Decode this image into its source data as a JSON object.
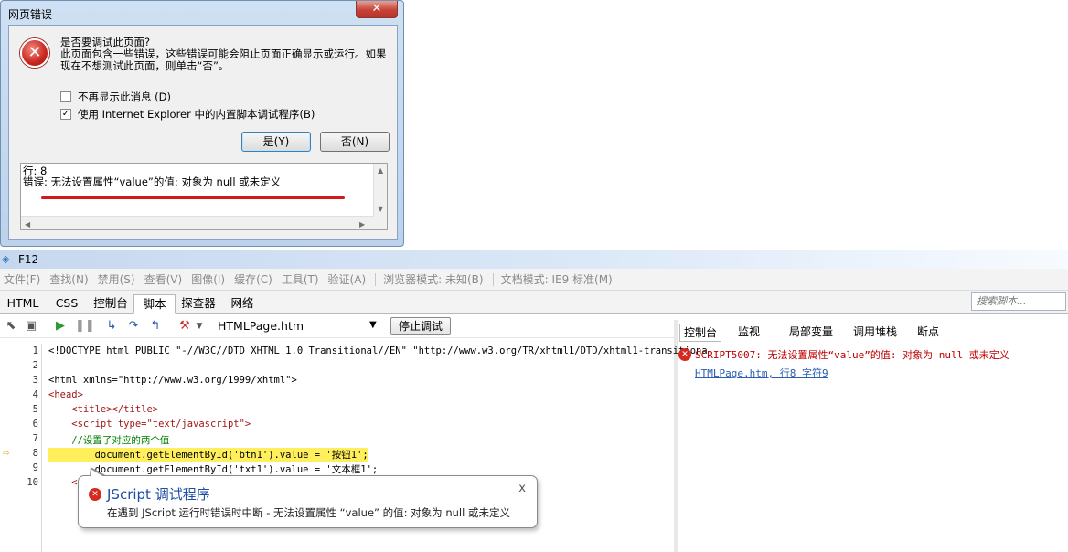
{
  "dialog": {
    "title": "网页错误",
    "close_label": "✕",
    "question": "是否要调试此页面?",
    "message": "此页面包含一些错误，这些错误可能会阻止页面正确显示或运行。如果现在不想测试此页面，则单击“否”。",
    "checkbox_no_show": "不再显示此消息 (D)",
    "checkbox_no_show_checked": false,
    "checkbox_use_debugger": "使用 Internet Explorer 中的内置脚本调试程序(B)",
    "checkbox_use_debugger_checked": true,
    "yes_button": "是(Y)",
    "no_button": "否(N)",
    "detail_line1": "行: 8",
    "detail_line2": "错误: 无法设置属性“value”的值: 对象为 null 或未定义"
  },
  "f12": {
    "title": "F12",
    "menu": [
      "文件(F)",
      "查找(N)",
      "禁用(S)",
      "查看(V)",
      "图像(I)",
      "缓存(C)",
      "工具(T)",
      "验证(A)"
    ],
    "browser_mode": "浏览器模式: 未知(B)",
    "doc_mode": "文档模式: IE9 标准(M)",
    "tabs": [
      "HTML",
      "CSS",
      "控制台",
      "脚本",
      "探查器",
      "网络"
    ],
    "active_tab": "脚本",
    "search_placeholder": "搜索脚本...",
    "file_select": "HTMLPage.htm",
    "stop_debug_button": "停止调试",
    "code_lines": [
      {
        "n": "1",
        "text": "<!DOCTYPE html PUBLIC \"-//W3C//DTD XHTML 1.0 Transitional//EN\" \"http://www.w3.org/TR/xhtml1/DTD/xhtml1-transitiona"
      },
      {
        "n": "2",
        "text": ""
      },
      {
        "n": "3",
        "text": "<html xmlns=\"http://www.w3.org/1999/xhtml\">"
      },
      {
        "n": "4",
        "text": "<head>"
      },
      {
        "n": "5",
        "text": "    <title></title>"
      },
      {
        "n": "6",
        "text": "    <script type=\"text/javascript\">"
      },
      {
        "n": "7",
        "text": "    //设置了对应的两个值"
      },
      {
        "n": "8",
        "text": "        document.getElementById('btn1').value = '按钮1';"
      },
      {
        "n": "9",
        "text": "        document.getElementById('txt1').value = '文本框1';"
      },
      {
        "n": "10",
        "text": "    <"
      }
    ],
    "tooltip_title": "JScript 调试程序",
    "tooltip_text": "在遇到 JScript 运行时错误时中断 - 无法设置属性 “value” 的值: 对象为 null 或未定义",
    "tooltip_close": "x",
    "right_tabs": [
      "控制台",
      "监视",
      "局部变量",
      "调用堆栈",
      "断点"
    ],
    "right_active": "控制台",
    "console_error": "SCRIPT5007: 无法设置属性“value”的值: 对象为 null 或未定义",
    "console_link": "HTMLPage.htm, 行8 字符9"
  }
}
